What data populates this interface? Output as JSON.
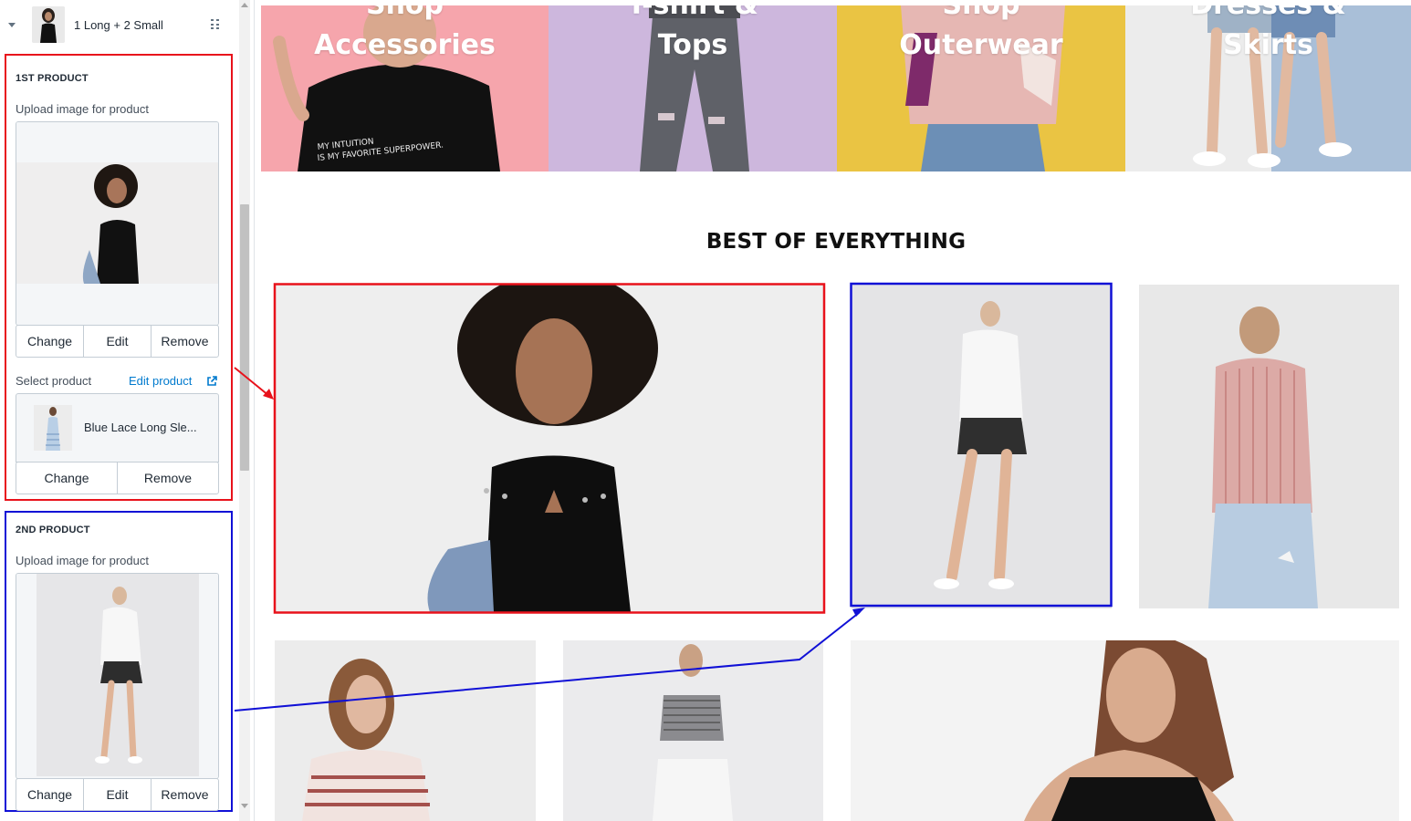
{
  "editor": {
    "block": {
      "title": "1 Long + 2 Small"
    },
    "first_product": {
      "title": "1ST PRODUCT",
      "upload_label": "Upload image for product",
      "image_buttons": [
        "Change",
        "Edit",
        "Remove"
      ],
      "select_label": "Select product",
      "edit_link": "Edit product",
      "product_name": "Blue Lace Long Sle...",
      "product_buttons": [
        "Change",
        "Remove"
      ]
    },
    "second_product": {
      "title": "2ND PRODUCT",
      "upload_label": "Upload image for product",
      "image_buttons": [
        "Change",
        "Edit",
        "Remove"
      ]
    }
  },
  "preview": {
    "categories": [
      {
        "label": "Shop\nAccessories",
        "bg": "#f6a5ac"
      },
      {
        "label": "T-shirt &\nTops",
        "bg": "#cdb7dd"
      },
      {
        "label": "Shop\nOuterwear",
        "bg": "#eac443"
      },
      {
        "label": "Dresses &\nSkirts",
        "bg": "#a9bfd8"
      }
    ],
    "section_heading": "BEST OF EVERYTHING"
  },
  "colors": {
    "highlight_red": "#e8121b",
    "highlight_blue": "#1010d6",
    "link": "#007ace"
  }
}
